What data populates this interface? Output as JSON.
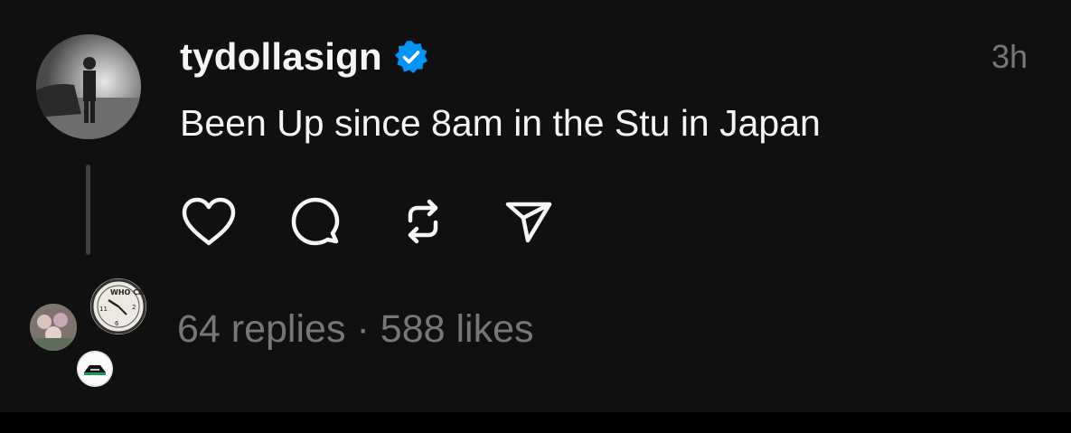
{
  "post": {
    "username": "tydollasign",
    "verified": true,
    "timestamp": "3h",
    "text": "Been Up since 8am in the Stu in Japan"
  },
  "actions": {
    "like_icon": "heart-icon",
    "reply_icon": "comment-bubble-icon",
    "repost_icon": "repost-icon",
    "share_icon": "share-send-icon"
  },
  "stats": {
    "replies": "64 replies",
    "separator": "·",
    "likes": "588 likes"
  },
  "avatar_clock_text": "WHO CARES",
  "colors": {
    "background": "#101010",
    "text": "#f3f5f7",
    "muted": "#777777",
    "verified_blue": "#0095f6"
  }
}
